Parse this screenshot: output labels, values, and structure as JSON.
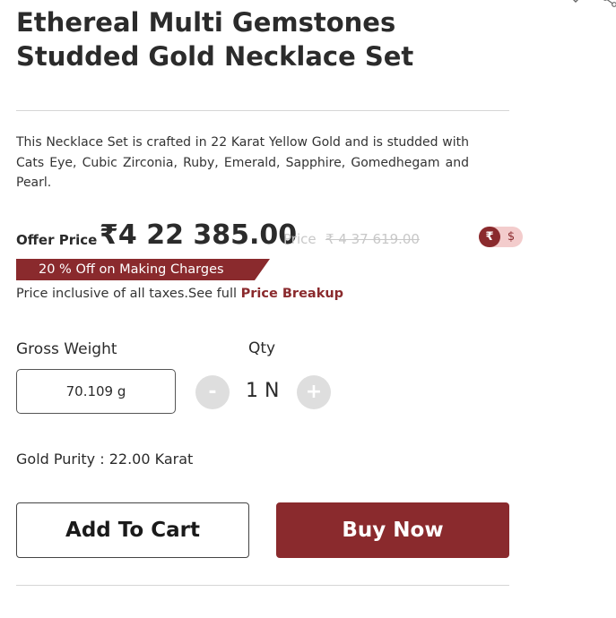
{
  "product": {
    "title": "Ethereal Multi Gemstones Studded Gold Necklace Set",
    "description": "This Necklace Set is crafted in 22 Karat Yellow Gold and is studded with Cats Eye, Cubic Zirconia, Ruby, Emerald, Sapphire, Gomedhegam and Pearl."
  },
  "pricing": {
    "offer_label": "Offer Price",
    "offer_value": "₹4 22 385.00",
    "mrp_label": "Price",
    "mrp_value": "₹ 4 37 619.00",
    "discount_text": "20 % Off on Making Charges",
    "tax_text": "Price inclusive of all taxes.See full ",
    "breakup_link": "Price Breakup"
  },
  "currency_toggle": {
    "options": [
      "₹",
      "$"
    ],
    "selected": "₹"
  },
  "weight": {
    "label": "Gross Weight",
    "value": "70.109 g"
  },
  "quantity": {
    "label": "Qty",
    "value": "1 N",
    "minus": "-",
    "plus": "+"
  },
  "purity": {
    "text": "Gold Purity : 22.00 Karat"
  },
  "actions": {
    "add_to_cart": "Add To Cart",
    "buy_now": "Buy Now"
  },
  "colors": {
    "accent": "#8a2a2d",
    "accent_light": "#f3cccc",
    "stepper_bg": "#dedede",
    "divider": "#d6d6d6"
  },
  "icons": {
    "corner_left": "chevron-down-icon",
    "corner_right": "share-icon"
  }
}
